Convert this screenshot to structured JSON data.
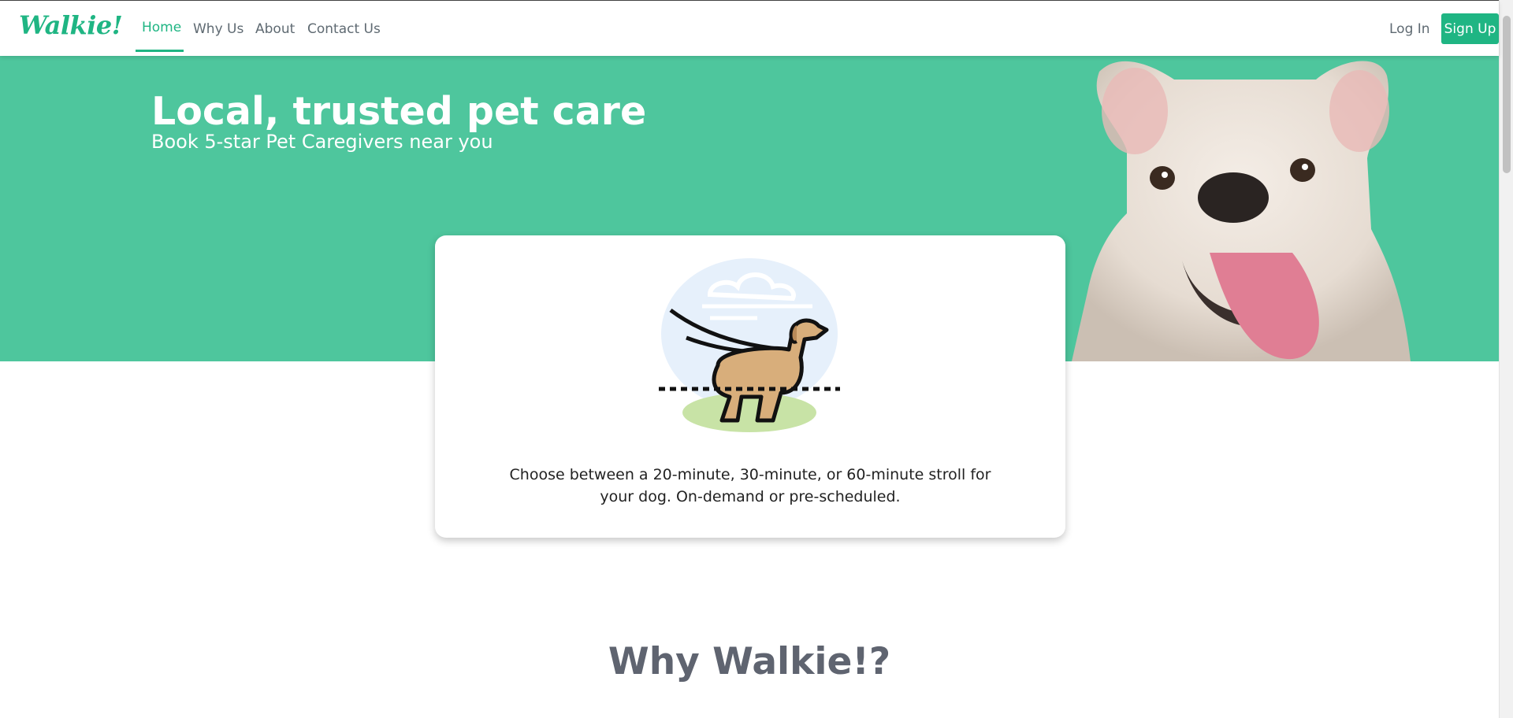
{
  "nav": {
    "logo": "Walkie!",
    "links": [
      "Home",
      "Why Us",
      "About",
      "Contact Us"
    ],
    "active": "Home",
    "login": "Log In",
    "signup": "Sign Up"
  },
  "hero": {
    "title": "Local, trusted pet care",
    "subtitle": "Book 5-star Pet Caregivers near you"
  },
  "card": {
    "description": "Choose between a 20-minute, 30-minute, or 60-minute stroll for your dog. On-demand or pre-scheduled."
  },
  "why": {
    "title": "Why Walkie!?"
  },
  "colors": {
    "brand": "#1fb583",
    "hero_bg": "#4ec69d"
  },
  "icons": [
    "dog-walking-icon"
  ]
}
